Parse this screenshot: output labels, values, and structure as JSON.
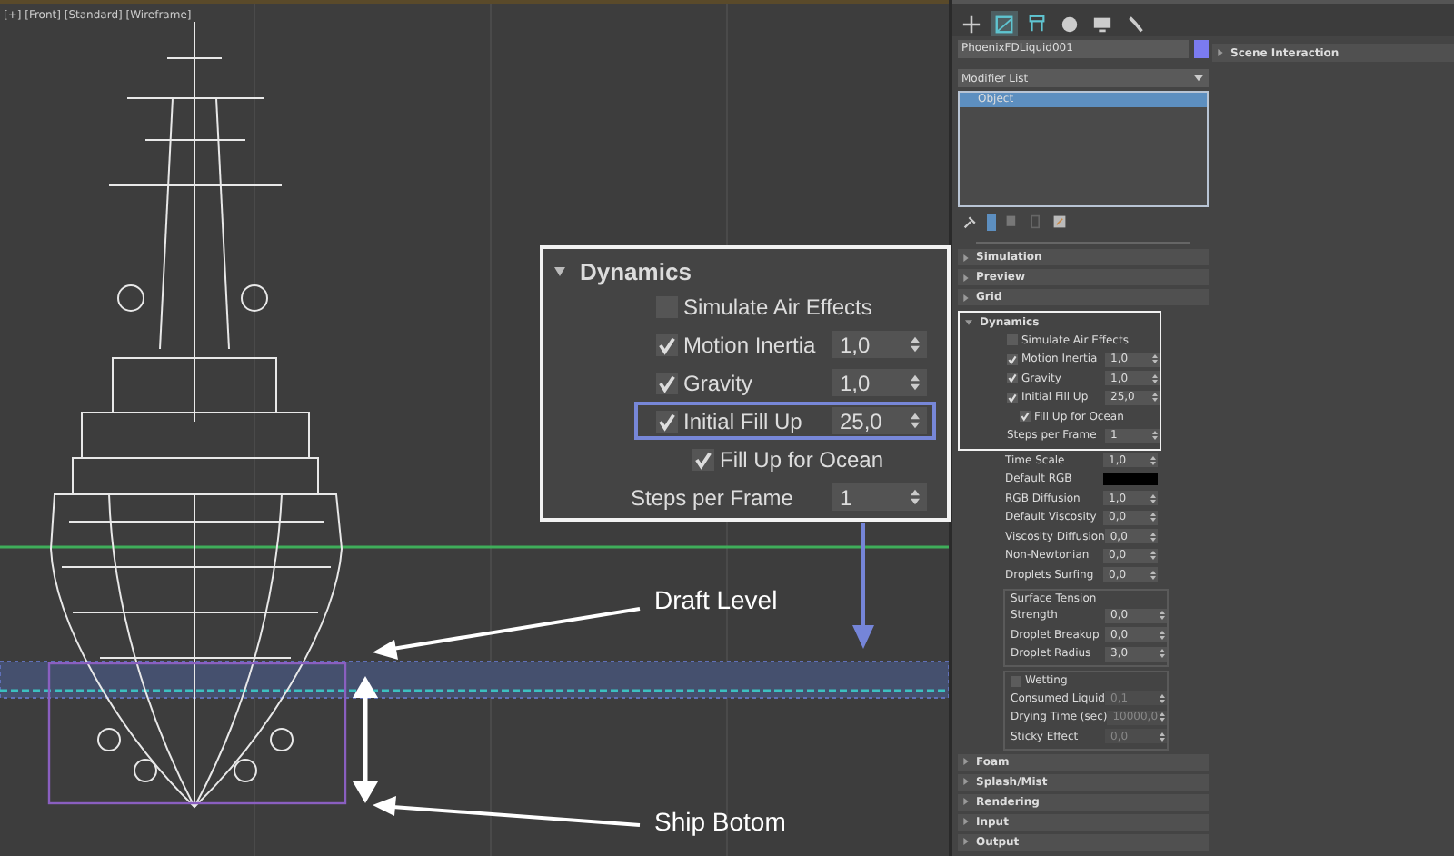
{
  "viewport": {
    "label": "[+] [Front] [Standard] [Wireframe]"
  },
  "annotations": [
    {
      "kind": "draft",
      "text": "Draft Level"
    },
    {
      "kind": "bottom",
      "text": "Ship Botom"
    }
  ],
  "callout": {
    "title": "Dynamics",
    "params": [
      {
        "kind": "check",
        "label": "Simulate Air Effects",
        "checked": false,
        "indent": false,
        "highlighted": false
      },
      {
        "kind": "check",
        "label": "Motion Inertia",
        "checked": true,
        "value": "1,0",
        "indent": false,
        "highlighted": false
      },
      {
        "kind": "check",
        "label": "Gravity",
        "checked": true,
        "value": "1,0",
        "indent": false,
        "highlighted": false
      },
      {
        "kind": "check",
        "label": "Initial Fill Up",
        "checked": true,
        "value": "25,0",
        "indent": false,
        "highlighted": true
      },
      {
        "kind": "check",
        "label": "Fill Up for Ocean",
        "checked": true,
        "indent": true,
        "highlighted": false
      },
      {
        "kind": "number",
        "label": "Steps per Frame",
        "value": "1",
        "highlighted": false
      }
    ]
  },
  "panel": {
    "tabs": [
      {
        "selected": false
      },
      {
        "selected": true
      },
      {
        "selected": false
      },
      {
        "selected": false
      },
      {
        "selected": false
      },
      {
        "selected": false
      }
    ],
    "object_name": "PhoenixFDLiquid001",
    "modifier_list": "Modifier List",
    "stack": [
      {
        "label": "Object",
        "selected": true
      }
    ],
    "rollouts_before": [
      "Simulation",
      "Preview",
      "Grid"
    ],
    "dynamics": {
      "title": "Dynamics",
      "highlighted": true,
      "params": [
        {
          "kind": "check",
          "label": "Simulate Air Effects",
          "checked": false,
          "indent": false
        },
        {
          "kind": "check",
          "label": "Motion Inertia",
          "checked": true,
          "value": "1,0",
          "indent": false
        },
        {
          "kind": "check",
          "label": "Gravity",
          "checked": true,
          "value": "1,0",
          "indent": false
        },
        {
          "kind": "check",
          "label": "Initial Fill Up",
          "checked": true,
          "value": "25,0",
          "indent": false
        },
        {
          "kind": "check",
          "label": "Fill Up for Ocean",
          "checked": true,
          "indent": true
        },
        {
          "kind": "number",
          "label": "Steps per Frame",
          "value": "1",
          "disabled": false
        }
      ],
      "more_params": [
        {
          "kind": "number",
          "label": "Time Scale",
          "value": "1,0",
          "disabled": false
        },
        {
          "kind": "color",
          "label": "Default RGB",
          "color": "#000000"
        },
        {
          "kind": "number",
          "label": "RGB Diffusion",
          "value": "1,0",
          "disabled": false
        },
        {
          "kind": "number",
          "label": "Default Viscosity",
          "value": "0,0",
          "disabled": false
        },
        {
          "kind": "number",
          "label": "Viscosity Diffusion",
          "value": "0,0",
          "disabled": false
        },
        {
          "kind": "number",
          "label": "Non-Newtonian",
          "value": "0,0",
          "disabled": false
        },
        {
          "kind": "number",
          "label": "Droplets Surfing",
          "value": "0,0",
          "disabled": false
        },
        {
          "kind": "group",
          "title": "Surface Tension",
          "children": [
            {
              "kind": "number",
              "label": "Strength",
              "value": "0,0",
              "disabled": false
            },
            {
              "kind": "number",
              "label": "Droplet Breakup",
              "value": "0,0",
              "disabled": false
            },
            {
              "kind": "number",
              "label": "Droplet Radius",
              "value": "3,0",
              "disabled": false
            }
          ]
        },
        {
          "kind": "group",
          "title": "Wetting",
          "checked": false,
          "children": [
            {
              "kind": "number",
              "label": "Consumed Liquid",
              "value": "0,1",
              "disabled": true
            },
            {
              "kind": "number",
              "label": "Drying Time (sec)",
              "value": "10000,0",
              "disabled": true
            },
            {
              "kind": "number",
              "label": "Sticky Effect",
              "value": "0,0",
              "disabled": true
            }
          ]
        }
      ]
    },
    "rollouts_after": [
      "Foam",
      "Splash/Mist",
      "Rendering",
      "Input",
      "Output"
    ],
    "side_rollout": "Scene Interaction"
  }
}
